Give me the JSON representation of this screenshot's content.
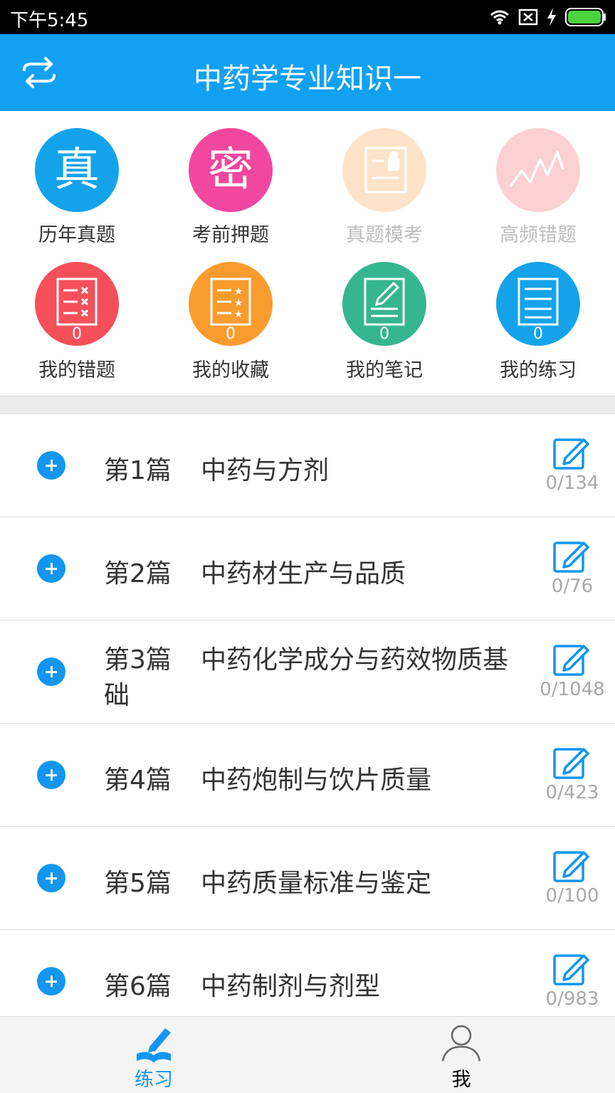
{
  "status_bar": {
    "time": "下午5:45"
  },
  "header": {
    "title": "中药学专业知识一",
    "switch_icon": "swap-arrows-icon"
  },
  "grid": [
    {
      "label": "历年真题",
      "glyph": "真",
      "color": "#14a3ea",
      "enabled": true
    },
    {
      "label": "考前押题",
      "glyph": "密",
      "color": "#f2479e",
      "enabled": true
    },
    {
      "label": "真题模考",
      "glyph": "",
      "color": "#fde4c8",
      "enabled": false
    },
    {
      "label": "高频错题",
      "glyph": "",
      "color": "#fdd0d3",
      "enabled": false
    },
    {
      "label": "我的错题",
      "count": "0",
      "color": "#f5505a"
    },
    {
      "label": "我的收藏",
      "count": "0",
      "color": "#f99c2f"
    },
    {
      "label": "我的笔记",
      "count": "0",
      "color": "#36b591"
    },
    {
      "label": "我的练习",
      "count": "0",
      "color": "#14a3ea"
    }
  ],
  "chapters": [
    {
      "chapter": "第1篇",
      "name": "中药与方剂",
      "progress": "0/134"
    },
    {
      "chapter": "第2篇",
      "name": "中药材生产与品质",
      "progress": "0/76"
    },
    {
      "chapter": "第3篇",
      "name": "中药化学成分与药效物质基",
      "name_cont": "础",
      "progress": "0/1048"
    },
    {
      "chapter": "第4篇",
      "name": "中药炮制与饮片质量",
      "progress": "0/423"
    },
    {
      "chapter": "第5篇",
      "name": "中药质量标准与鉴定",
      "progress": "0/100"
    },
    {
      "chapter": "第6篇",
      "name": "中药制剂与剂型",
      "progress": "0/983"
    }
  ],
  "bottom_nav": [
    {
      "label": "练习",
      "icon": "practice-pencil-book-icon",
      "active": true
    },
    {
      "label": "我",
      "icon": "person-icon",
      "active": false
    }
  ],
  "colors": {
    "primary": "#12a0f3",
    "accent": "#1296f0"
  }
}
